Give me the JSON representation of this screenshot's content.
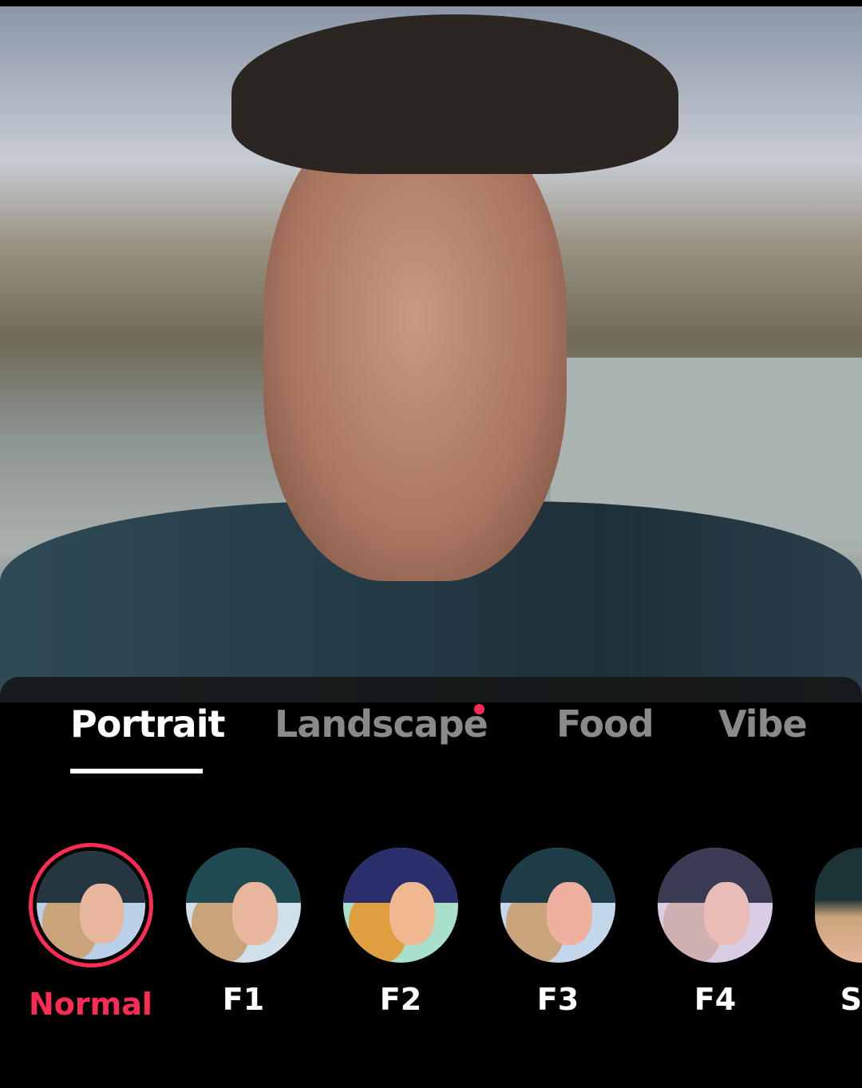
{
  "camera_preview": {
    "description_icon": "selfie-camera-preview"
  },
  "categories": {
    "tabs": [
      {
        "label": "Portrait",
        "active": true
      },
      {
        "label": "Landscape",
        "active": false,
        "has_new_dot": true
      },
      {
        "label": "Food",
        "active": false
      },
      {
        "label": "Vibe",
        "active": false
      }
    ]
  },
  "filters": {
    "items": [
      {
        "label": "Normal",
        "selected": true,
        "tint": "#b8d0e8"
      },
      {
        "label": "F1",
        "selected": false,
        "tint": "#cfe0ea"
      },
      {
        "label": "F2",
        "selected": false,
        "tint": "#a8e0cc"
      },
      {
        "label": "F3",
        "selected": false,
        "tint": "#c4d8ec"
      },
      {
        "label": "F4",
        "selected": false,
        "tint": "#d8cde4"
      },
      {
        "label": "S",
        "selected": false,
        "tint": "#8aa0a8"
      }
    ]
  },
  "colors": {
    "accent": "#fe2c55",
    "inactive_tab": "#8a8a8a"
  }
}
